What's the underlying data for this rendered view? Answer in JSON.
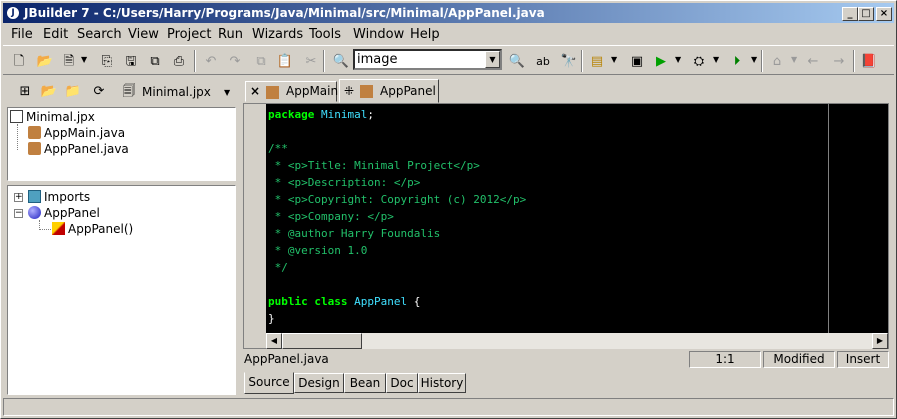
{
  "window": {
    "title": "JBuilder 7 - C:/Users/Harry/Programs/Java/Minimal/src/Minimal/AppPanel.java",
    "app_icon_glyph": "J"
  },
  "window_controls": {
    "minimize": "_",
    "maximize": "□",
    "close": "×"
  },
  "menu": [
    "File",
    "Edit",
    "Search",
    "View",
    "Project",
    "Run",
    "Wizards",
    "Tools",
    "Window",
    "Help"
  ],
  "toolbar": {
    "search_value": "image"
  },
  "project": {
    "selector_label": "Minimal.jpx"
  },
  "project_tree": [
    {
      "label": "Minimal.jpx",
      "icon": "project-file-icon"
    },
    {
      "label": "AppMain.java",
      "icon": "java-file-icon"
    },
    {
      "label": "AppPanel.java",
      "icon": "java-file-icon"
    }
  ],
  "structure_tree": [
    {
      "label": "Imports",
      "icon": "package-icon",
      "expander": "+"
    },
    {
      "label": "AppPanel",
      "icon": "class-icon",
      "expander": "−"
    },
    {
      "label": "AppPanel()",
      "icon": "method-icon",
      "expander": ""
    }
  ],
  "editor_tabs": [
    {
      "label": "AppMain",
      "close": "×"
    },
    {
      "label": "AppPanel",
      "close": "⁜"
    }
  ],
  "code_lines": [
    [
      {
        "t": "kw",
        "s": "package"
      },
      {
        "t": "id",
        "s": " Minimal"
      },
      {
        "t": "pn",
        "s": ";"
      }
    ],
    [],
    [
      {
        "t": "cm",
        "s": "/**"
      }
    ],
    [
      {
        "t": "cm",
        "s": " * <p>Title: Minimal Project</p>"
      }
    ],
    [
      {
        "t": "cm",
        "s": " * <p>Description: </p>"
      }
    ],
    [
      {
        "t": "cm",
        "s": " * <p>Copyright: Copyright (c) 2012</p>"
      }
    ],
    [
      {
        "t": "cm",
        "s": " * <p>Company: </p>"
      }
    ],
    [
      {
        "t": "cm",
        "s": " * @author Harry Foundalis"
      }
    ],
    [
      {
        "t": "cm",
        "s": " * @version 1.0"
      }
    ],
    [
      {
        "t": "cm",
        "s": " */"
      }
    ],
    [],
    [
      {
        "t": "kw",
        "s": "public class"
      },
      {
        "t": "id",
        "s": " AppPanel "
      },
      {
        "t": "pn",
        "s": "{"
      }
    ],
    [
      {
        "t": "pn",
        "s": "}"
      }
    ]
  ],
  "status": {
    "file": "AppPanel.java",
    "position": "1:1",
    "state": "Modified",
    "mode": "Insert"
  },
  "bottom_tabs": [
    "Source",
    "Design",
    "Bean",
    "Doc",
    "History"
  ],
  "colors": {
    "keyword": "#00ff00",
    "identifier": "#40e0ff",
    "comment": "#22c06a",
    "editor_bg": "#000000"
  }
}
